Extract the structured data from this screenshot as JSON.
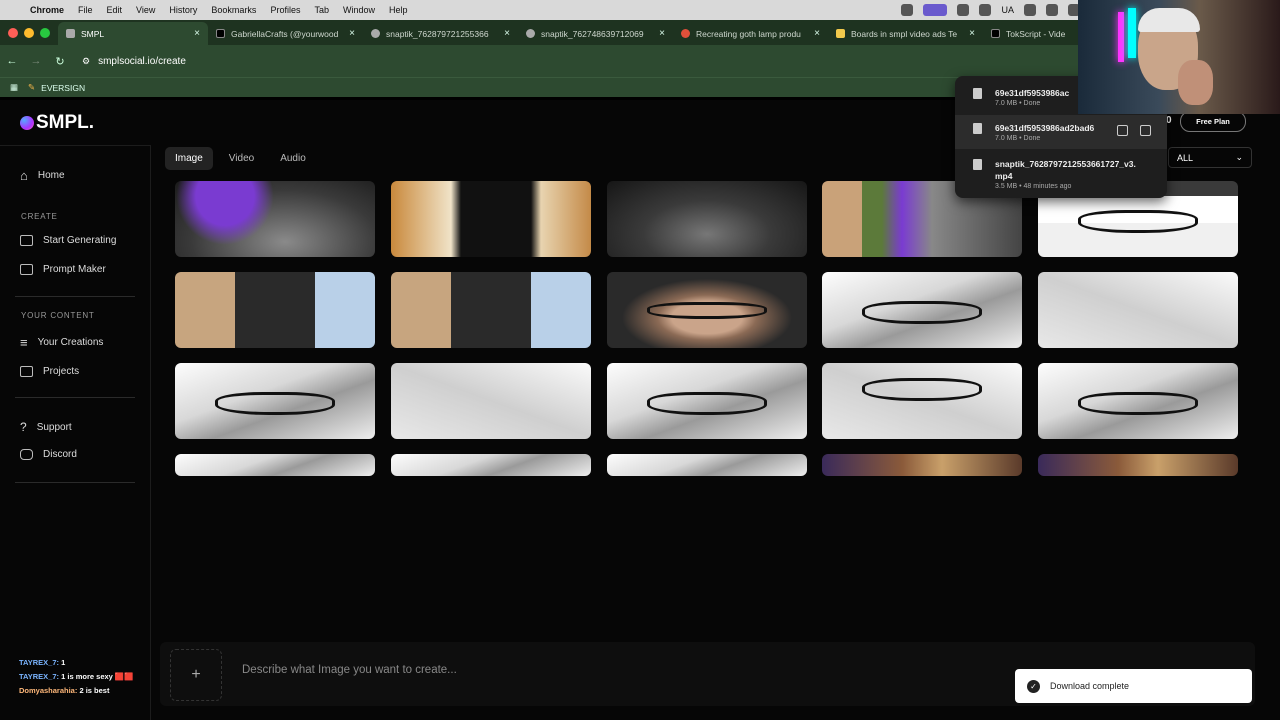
{
  "menubar": {
    "app": "Chrome",
    "items": [
      "File",
      "Edit",
      "View",
      "History",
      "Bookmarks",
      "Profiles",
      "Tab",
      "Window",
      "Help"
    ],
    "input_source": "UA"
  },
  "tabs": [
    {
      "label": "SMPL",
      "active": true
    },
    {
      "label": "GabriellaCrafts (@yourwood",
      "active": false
    },
    {
      "label": "snaptik_762879721255366",
      "active": false
    },
    {
      "label": "snaptik_762748639712069",
      "active": false
    },
    {
      "label": "Recreating goth lamp produ",
      "active": false
    },
    {
      "label": "Boards in smpl video ads Te",
      "active": false
    },
    {
      "label": "TokScript - Video T",
      "active": false
    }
  ],
  "address": {
    "url": "smplsocial.io/create"
  },
  "bookmarks": [
    {
      "label": "EVERSIGN"
    }
  ],
  "app": {
    "logo": "SMPL.",
    "credits": "0",
    "plan_label": "Free Plan"
  },
  "sidebar": {
    "home": "Home",
    "create_section": "CREATE",
    "start_generating": "Start Generating",
    "prompt_maker": "Prompt Maker",
    "content_section": "YOUR CONTENT",
    "your_creations": "Your Creations",
    "projects": "Projects",
    "support": "Support",
    "discord": "Discord"
  },
  "chat": [
    {
      "user": "TAYREX_7:",
      "msg": "1"
    },
    {
      "user": "TAYREX_7:",
      "msg": "1 is more sexy 🟥🟥"
    },
    {
      "user": "Domyasharahia:",
      "msg": "2 is best"
    }
  ],
  "media_tabs": [
    "Image",
    "Video",
    "Audio"
  ],
  "filter": {
    "value": "ALL"
  },
  "prompt": {
    "placeholder": "Describe what Image you want to create...",
    "add_icon": "+"
  },
  "downloads": [
    {
      "name": "69e31df5953986ac",
      "meta": "7.0 MB • Done"
    },
    {
      "name": "69e31df5953986ad2bad6",
      "meta": "7.0 MB • Done"
    },
    {
      "name": "snaptik_7628797212553661727_v3.",
      "name2": "mp4",
      "meta": "3.5 MB • 48 minutes ago"
    }
  ],
  "toast": {
    "message": "Download complete"
  }
}
